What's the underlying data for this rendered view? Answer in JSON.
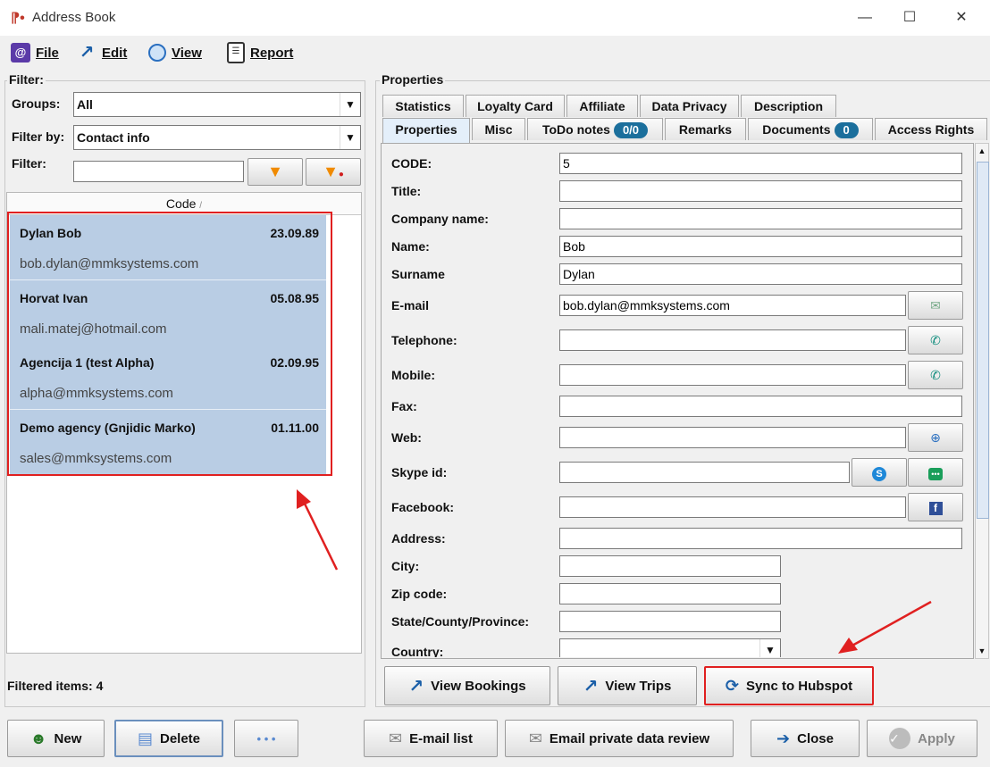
{
  "window": {
    "title": "Address Book",
    "minimize": "—",
    "maximize": "☐",
    "close": "✕"
  },
  "menu": [
    {
      "label": "File",
      "icon": "at-icon"
    },
    {
      "label": "Edit",
      "icon": "edit-arrow-icon"
    },
    {
      "label": "View",
      "icon": "magnifier-icon"
    },
    {
      "label": "Report",
      "icon": "clipboard-icon"
    }
  ],
  "filter": {
    "section_label": "Filter:",
    "groups_label": "Groups:",
    "groups_value": "All",
    "filter_by_label": "Filter by:",
    "filter_by_value": "Contact info",
    "filter_label": "Filter:",
    "filter_value": "",
    "column_header": "Code",
    "sort_indicator": "/",
    "filtered_items": "Filtered items: 4"
  },
  "contacts": [
    {
      "name": "Dylan Bob",
      "date": "23.09.89",
      "email": "bob.dylan@mmksystems.com"
    },
    {
      "name": "Horvat Ivan",
      "date": "05.08.95",
      "email": "mali.matej@hotmail.com"
    },
    {
      "name": "Agencija 1 (test Alpha)",
      "date": "02.09.95",
      "email": "alpha@mmksystems.com"
    },
    {
      "name": "Demo agency (Gnjidic Marko)",
      "date": "01.11.00",
      "email": "sales@mmksystems.com"
    }
  ],
  "properties": {
    "section_label": "Properties",
    "tabs_row1": [
      "Statistics",
      "Loyalty Card",
      "Affiliate",
      "Data Privacy",
      "Description"
    ],
    "tabs_row2": [
      "Properties",
      "Misc",
      "ToDo notes",
      "Remarks",
      "Documents",
      "Access Rights"
    ],
    "todo_badge": "0/0",
    "documents_badge": "0",
    "active_tab": "Properties",
    "fields": {
      "code": {
        "label": "CODE:",
        "value": "5"
      },
      "title": {
        "label": "Title:",
        "value": ""
      },
      "company": {
        "label": "Company name:",
        "value": ""
      },
      "name": {
        "label": "Name:",
        "value": "Bob"
      },
      "surname": {
        "label": "Surname",
        "value": "Dylan"
      },
      "email": {
        "label": "E-mail",
        "value": "bob.dylan@mmksystems.com"
      },
      "telephone": {
        "label": "Telephone:",
        "value": ""
      },
      "mobile": {
        "label": "Mobile:",
        "value": ""
      },
      "fax": {
        "label": "Fax:",
        "value": ""
      },
      "web": {
        "label": "Web:",
        "value": ""
      },
      "skype": {
        "label": "Skype id:",
        "value": ""
      },
      "facebook": {
        "label": "Facebook:",
        "value": ""
      },
      "address": {
        "label": "Address:",
        "value": ""
      },
      "city": {
        "label": "City:",
        "value": ""
      },
      "zip": {
        "label": "Zip code:",
        "value": ""
      },
      "state": {
        "label": "State/County/Province:",
        "value": ""
      },
      "country": {
        "label": "Country:",
        "value": ""
      }
    },
    "view_bookings": "View Bookings",
    "view_trips": "View Trips",
    "sync_hubspot": "Sync to Hubspot"
  },
  "bottom": {
    "new": "New",
    "delete": "Delete",
    "more": "• • •",
    "email_list": "E-mail list",
    "email_private": "Email private data review",
    "close": "Close",
    "apply": "Apply"
  },
  "colors": {
    "accent": "#1b6f9c",
    "highlight_red": "#e02020",
    "row_bg": "#b9cde4"
  }
}
